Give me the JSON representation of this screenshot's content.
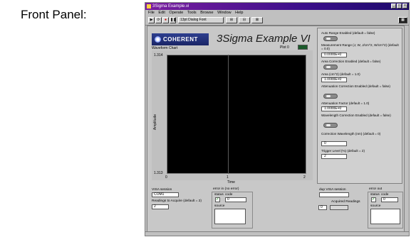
{
  "caption": "Front Panel:",
  "window": {
    "title": "3Sigma Example.vi",
    "menu": [
      "File",
      "Edit",
      "Operate",
      "Tools",
      "Browse",
      "Window",
      "Help"
    ],
    "font_select": "13pt Dialog Font"
  },
  "header": {
    "logo_text": "COHERENT",
    "vi_title": "3Sigma Example VI"
  },
  "chart": {
    "label": "Waveform Chart",
    "plot_label": "Plot 0",
    "y_max": "1.314",
    "y_min": "1.313",
    "y_label": "Amplitude",
    "x_ticks": [
      "0",
      "1",
      "2"
    ],
    "x_label": "Time"
  },
  "controls": {
    "auto_range_label": "Auto Range Enabled (default = false)",
    "meas_range_label": "Measurement Range (J, W, J/cm^2, W/cm^2) (default = 0.0)",
    "meas_range_value": "0.0000E+0",
    "area_corr_label": "Area Correction Enabled (default = false)",
    "area_label": "Area (cm^2) (default = 1.0)",
    "area_value": "1.0000E+0",
    "atten_corr_label": "Attenuation Correction Enabled (default = false)",
    "atten_factor_label": "Attenuation Factor (default = 1.0)",
    "atten_factor_value": "1.0000E+0",
    "wl_corr_label": "Wavelength Correction Enabled (default = false)",
    "corr_wl_label": "Correction Wavelength (nm) (default = 0)",
    "corr_wl_value": "0",
    "trigger_label": "Trigger Level (%) (default = 2)",
    "trigger_value": "2"
  },
  "bottom": {
    "visa_label": "VISA session",
    "visa_value": "COM1",
    "readings_label": "Readings to Acquire (default = 2)",
    "readings_value": "2",
    "error_in_label": "error in (no error)",
    "status_label": "status",
    "code_label": "code",
    "code_value": "0",
    "source_label": "source",
    "dup_visa_label": "dup VISA session",
    "acquired_label": "Acquired Readings",
    "acquired_value": "0",
    "error_out_label": "error out"
  }
}
